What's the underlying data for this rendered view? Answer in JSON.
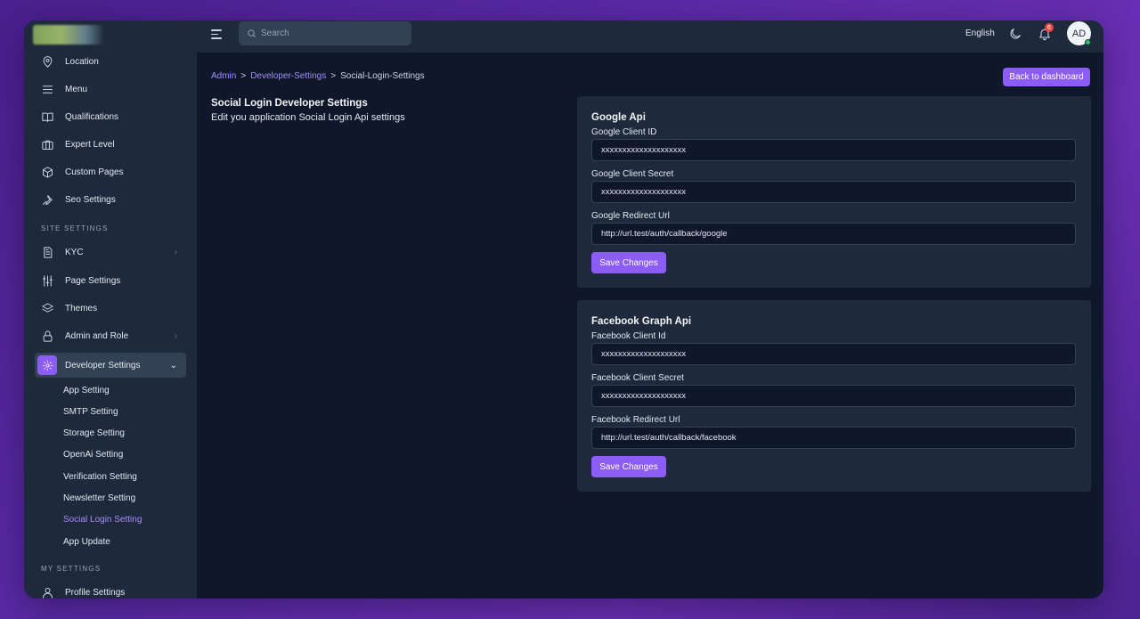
{
  "sidebar": {
    "items": [
      {
        "label": "Location",
        "icon": "map-pin-icon"
      },
      {
        "label": "Menu",
        "icon": "menu-icon"
      },
      {
        "label": "Qualifications",
        "icon": "book-icon"
      },
      {
        "label": "Expert Level",
        "icon": "briefcase-icon"
      },
      {
        "label": "Custom Pages",
        "icon": "cube-icon"
      },
      {
        "label": "Seo Settings",
        "icon": "wrench-icon"
      }
    ],
    "site_settings_title": "SITE SETTINGS",
    "site_items": [
      {
        "label": "KYC",
        "icon": "document-icon",
        "chevron": "›"
      },
      {
        "label": "Page Settings",
        "icon": "sliders-icon"
      },
      {
        "label": "Themes",
        "icon": "layers-icon"
      },
      {
        "label": "Admin and Role",
        "icon": "lock-icon",
        "chevron": "›"
      },
      {
        "label": "Developer Settings",
        "icon": "gear-icon",
        "chevron": "⌄"
      }
    ],
    "developer_sub_items": [
      "App Setting",
      "SMTP Setting",
      "Storage Setting",
      "OpenAi Setting",
      "Verification Setting",
      "Newsletter Setting",
      "Social Login Setting",
      "App Update"
    ],
    "my_settings_title": "MY SETTINGS",
    "my_items": [
      {
        "label": "Profile Settings",
        "icon": "user-icon"
      }
    ]
  },
  "topbar": {
    "search_placeholder": "Search",
    "language": "English",
    "notification_count": "6",
    "avatar_initials": "AD"
  },
  "breadcrumb": {
    "items": [
      "Admin",
      "Developer-Settings",
      "Social-Login-Settings"
    ],
    "separator": ">"
  },
  "back_button": "Back to dashboard",
  "page": {
    "title": "Social Login Developer Settings",
    "subtitle": "Edit you application Social Login Api settings"
  },
  "google": {
    "title": "Google Api",
    "client_id_label": "Google Client ID",
    "client_id_value": "xxxxxxxxxxxxxxxxxxxx",
    "client_secret_label": "Google Client Secret",
    "client_secret_value": "xxxxxxxxxxxxxxxxxxxx",
    "redirect_label": "Google Redirect Url",
    "redirect_value": "http://url.test/auth/callback/google",
    "save_label": "Save Changes"
  },
  "facebook": {
    "title": "Facebook Graph Api",
    "client_id_label": "Facebook Client Id",
    "client_id_value": "xxxxxxxxxxxxxxxxxxxx",
    "client_secret_label": "Facebook Client Secret",
    "client_secret_value": "xxxxxxxxxxxxxxxxxxxx",
    "redirect_label": "Facebook Redirect Url",
    "redirect_value": "http://url.test/auth/callback/facebook",
    "save_label": "Save Changes"
  },
  "colors": {
    "accent": "#8b5cf6",
    "accent_text": "#a78bfa",
    "sidebar_bg": "#1e293b",
    "content_bg": "#0f172a",
    "badge": "#ef4444",
    "online": "#22c55e"
  }
}
